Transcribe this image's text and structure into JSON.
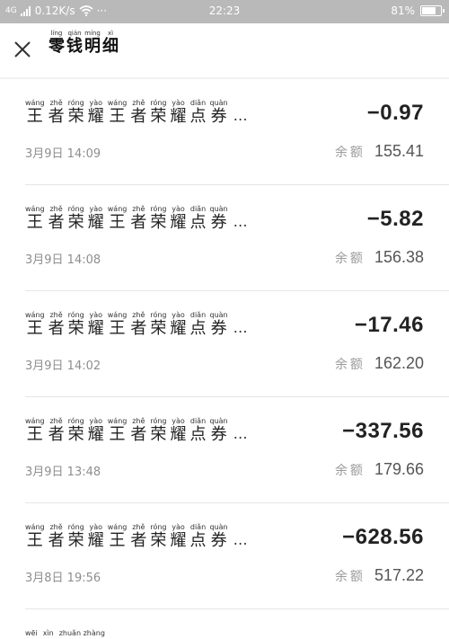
{
  "status_bar": {
    "network": "4G",
    "speed": "0.12K/s",
    "more": "···",
    "time": "22:23",
    "battery_percent_text": "81%",
    "battery_level": 0.81
  },
  "nav": {
    "title_chars": [
      {
        "py": "líng",
        "hz": "零"
      },
      {
        "py": "qián",
        "hz": "钱"
      },
      {
        "py": "míng",
        "hz": "明"
      },
      {
        "py": "xì",
        "hz": "细"
      }
    ]
  },
  "title_chars": [
    {
      "py": "wáng",
      "hz": "王"
    },
    {
      "py": "zhě",
      "hz": "者"
    },
    {
      "py": "róng",
      "hz": "荣"
    },
    {
      "py": "yào",
      "hz": "耀"
    },
    {
      "py": "wáng",
      "hz": "王"
    },
    {
      "py": "zhě",
      "hz": "者"
    },
    {
      "py": "róng",
      "hz": "荣"
    },
    {
      "py": "yào",
      "hz": "耀"
    },
    {
      "py": "diǎn",
      "hz": "点"
    },
    {
      "py": "quàn",
      "hz": "券"
    }
  ],
  "ellipsis": "…",
  "balance_label": "余额",
  "transactions": [
    {
      "amount": "−0.97",
      "date": "3月9日 14:09",
      "balance": "155.41"
    },
    {
      "amount": "−5.82",
      "date": "3月9日 14:08",
      "balance": "156.38"
    },
    {
      "amount": "−17.46",
      "date": "3月9日 14:02",
      "balance": "162.20"
    },
    {
      "amount": "−337.56",
      "date": "3月9日 13:48",
      "balance": "179.66"
    },
    {
      "amount": "−628.56",
      "date": "3月8日 19:56",
      "balance": "517.22"
    }
  ],
  "partial_row": {
    "chars": [
      {
        "py": "wēi"
      },
      {
        "py": "xìn"
      },
      {
        "py": "zhuǎn zhàng"
      }
    ]
  }
}
